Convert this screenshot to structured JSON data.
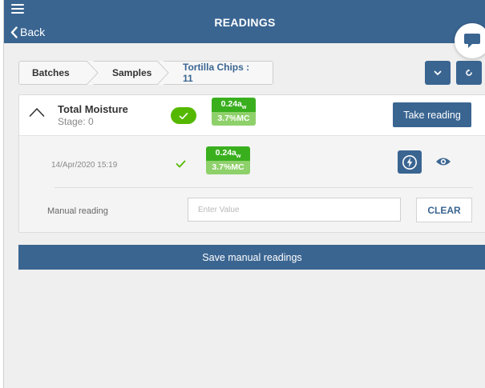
{
  "header": {
    "title": "READINGS",
    "back_label": "Back",
    "menu_icon": "hamburger-menu-icon",
    "chat_icon": "chat-bubble-icon"
  },
  "breadcrumb": {
    "items": [
      {
        "label": "Batches"
      },
      {
        "label": "Samples"
      },
      {
        "label": "Tortilla Chips : 11"
      }
    ]
  },
  "toolbar": {
    "dropdown_icon": "chevron-down-icon",
    "refresh_icon": "refresh-icon"
  },
  "test": {
    "name": "Total Moisture",
    "stage": "Stage: 0",
    "summary_reading": {
      "aw_value": "0.24a",
      "aw_sub": "w",
      "mc_value": "3.7%MC"
    },
    "take_reading_label": "Take reading",
    "readings": [
      {
        "timestamp": "14/Apr/2020 15:19",
        "aw_value": "0.24a",
        "aw_sub": "w",
        "mc_value": "3.7%MC"
      }
    ],
    "manual": {
      "label": "Manual reading",
      "placeholder": "Enter Value",
      "value": "",
      "clear_label": "CLEAR"
    }
  },
  "save_label": "Save manual readings",
  "colors": {
    "primary": "#3a6591",
    "success": "#55b800",
    "success_light": "#8ed06a",
    "background": "#efefef"
  }
}
